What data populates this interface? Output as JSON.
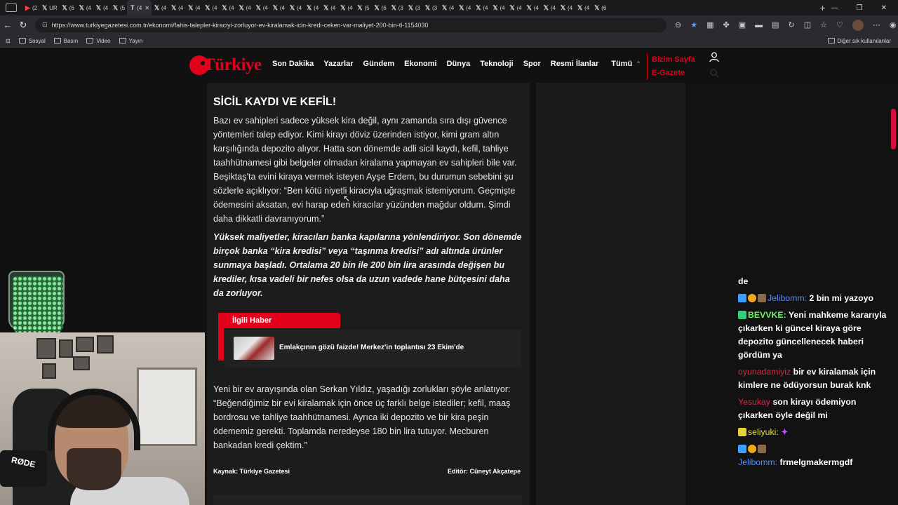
{
  "browser": {
    "tabs": [
      "(2",
      "UR",
      "(6",
      "(4",
      "(4",
      "(5",
      "(4",
      "(4",
      "(4",
      "(4",
      "(4",
      "(4",
      "(4",
      "(4",
      "(4",
      "(4",
      "(4",
      "(4",
      "(4",
      "(5",
      "(6",
      "(3",
      "(3",
      "(3",
      "(4",
      "(4",
      "(4",
      "(4",
      "(4",
      "(4",
      "(4",
      "(4",
      "(4",
      "(6"
    ],
    "url": "https://www.turkiyegazetesi.com.tr/ekonomi/fahis-talepler-kiraciyi-zorluyor-ev-kiralamak-icin-kredi-ceken-var-maliyet-200-bin-tl-1154030",
    "bookmarks": [
      "Sosyal",
      "Basın",
      "Video",
      "Yayın"
    ],
    "bookmarks_right": "Diğer sık kullanılanlar"
  },
  "site": {
    "logo": "Türkiye",
    "nav": [
      "Son Dakika",
      "Yazarlar",
      "Gündem",
      "Ekonomi",
      "Dünya",
      "Teknoloji",
      "Spor",
      "Resmi İlanlar",
      "Tümü"
    ],
    "bizim_sayfa": "Bizim Sayfa",
    "e_gazete": "E-Gazete"
  },
  "article": {
    "heading": "SİCİL KAYDI VE KEFİL!",
    "para1": "Bazı ev sahipleri sadece yüksek kira değil, aynı zamanda sıra dışı güvence yöntemleri talep ediyor. Kimi kirayı döviz üzerinden istiyor, kimi gram altın karşılığında depozito alıyor. Hatta son dönemde adli sicil kaydı, kefil, tahliye taahhütnamesi gibi belgeler olmadan kiralama yapmayan ev sahipleri bile var. Beşiktaş'ta evini kiraya vermek isteyen Ayşe Erdem, bu durumun sebebini şu sözlerle açıklıyor: “Ben kötü niyetli kiracıyla uğraşmak istemiyorum. Geçmişte ödemesini aksatan, evi harap eden kiracılar yüzünden mağdur oldum. Şimdi daha dikkatli davranıyorum.”",
    "para2": "Yüksek maliyetler, kiracıları banka kapılarına yönlendiriyor. Son dönemde birçok banka “kira kredisi” veya “taşınma kredisi” adı altında ürünler sunmaya başladı. Ortalama 20 bin ile 200 bin lira arasında değişen bu krediler, kısa vadeli bir nefes olsa da uzun vadede hane bütçesini daha da zorluyor.",
    "related_label": "İlgili Haber",
    "related_title": "Emlakçının gözü faizde! Merkez'in toplantısı 23 Ekim'de",
    "para3": "Yeni bir ev arayışında olan Serkan Yıldız, yaşadığı zorlukları şöyle anlatıyor: “Beğendiğimiz bir evi kiralamak için önce üç farklı belge istediler; kefil, maaş bordrosu ve tahliye taahhütnamesi. Ayrıca iki depozito ve bir kira peşin ödememiz gerekti. Toplamda neredeyse 180 bin lira tutuyor. Mecburen bankadan kredi çektim.”",
    "source": "Kaynak: Türkiye Gazetesi",
    "editor": "Editör: Cüneyt Akçatepe"
  },
  "stream": {
    "mic_label": "RØDE"
  },
  "chat": [
    {
      "user": "",
      "text": "de"
    },
    {
      "user": "Jelibomm:",
      "text": "2 bin mi yazoyo",
      "color": "blue"
    },
    {
      "user": "BEVVKE:",
      "text": "Yeni mahkeme kararıyla çıkarken ki güncel kiraya göre depozito güncellenecek haberi gördüm ya",
      "color": "green"
    },
    {
      "user": "oyunadamiyiz",
      "text": "bir ev kiralamak için kimlere ne ödüyorsun burak knk",
      "color": "red"
    },
    {
      "user": "Yesukay",
      "text": "son kirayı ödemiyon çıkarken öyle değil mi",
      "color": "red"
    },
    {
      "user": "seliyuki:",
      "text": "",
      "color": "yellow"
    },
    {
      "user": "Jelibomm:",
      "text": "frmelgmakermgdf",
      "color": "blue"
    }
  ]
}
